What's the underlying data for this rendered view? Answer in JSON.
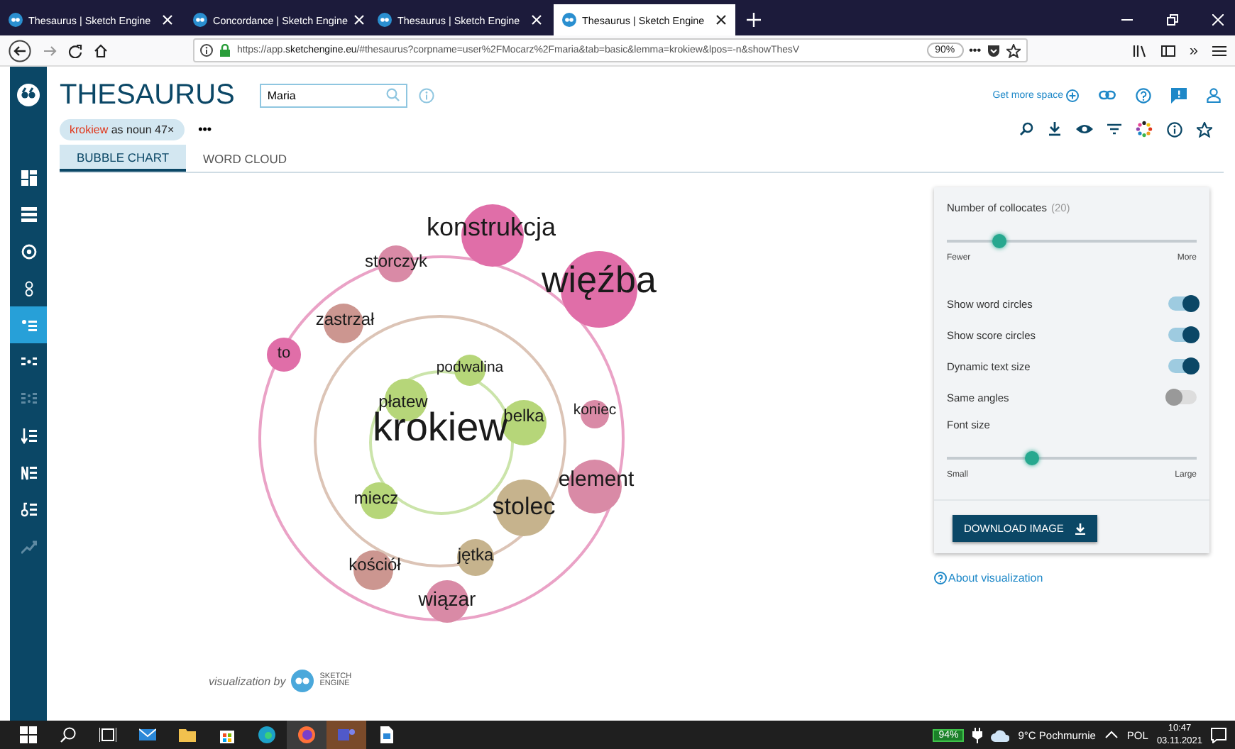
{
  "browser": {
    "tabs": [
      {
        "title": "Thesaurus | Sketch Engine",
        "selected": false
      },
      {
        "title": "Concordance | Sketch Engine",
        "selected": false
      },
      {
        "title": "Thesaurus | Sketch Engine",
        "selected": false
      },
      {
        "title": "Thesaurus | Sketch Engine",
        "selected": true
      }
    ],
    "url": "https://app.**sketchengine.eu**/#thesaurus?corpname=user%2FMocarz%2Fmaria&tab=basic&lemma=krokiew&lpos=-n&showThesV",
    "zoom": "90%",
    "overflow": "•••",
    "chevrons": "»"
  },
  "app": {
    "title": "THESAURUS",
    "search": {
      "value": "Maria"
    },
    "get_more_space": "Get more space",
    "query": {
      "lemma": "krokiew",
      "rest": "as noun 47×"
    },
    "more": "•••",
    "tabs": [
      {
        "label": "BUBBLE CHART",
        "selected": true
      },
      {
        "label": "WORD CLOUD",
        "selected": false
      }
    ],
    "sidebar": [
      {
        "selected": false
      },
      {
        "selected": false
      },
      {
        "selected": false
      },
      {
        "selected": false
      },
      {
        "selected": true
      },
      {
        "selected": false
      },
      {
        "selected": false
      },
      {
        "selected": false
      },
      {
        "selected": false
      },
      {
        "selected": false
      },
      {
        "selected": false
      }
    ]
  },
  "chart": {
    "headword": "krokiew",
    "bubbles": [
      {
        "word": "konstrukcja",
        "color": "#e06ea8"
      },
      {
        "word": "storczyk",
        "color": "#d98aa6"
      },
      {
        "word": "więźba",
        "color": "#e06ea8"
      },
      {
        "word": "zastrzał",
        "color": "#cc9690"
      },
      {
        "word": "to",
        "color": "#e06ea8"
      },
      {
        "word": "podwalina",
        "color": "#b6d679"
      },
      {
        "word": "płatew",
        "color": "#b6d679"
      },
      {
        "word": "belka",
        "color": "#b6d679"
      },
      {
        "word": "koniec",
        "color": "#d98aa6"
      },
      {
        "word": "element",
        "color": "#d98aa6"
      },
      {
        "word": "miecz",
        "color": "#b6d679"
      },
      {
        "word": "stolec",
        "color": "#c6b38d"
      },
      {
        "word": "jętka",
        "color": "#c6b38d"
      },
      {
        "word": "kościół",
        "color": "#cc9690"
      },
      {
        "word": "wiązar",
        "color": "#d98aa6"
      }
    ],
    "credit": "visualization by",
    "logo_text": "SKETCH ENGINE"
  },
  "panel": {
    "collocates": {
      "label": "Number of collocates",
      "count": "(20)",
      "level": 0.21,
      "min": "Fewer",
      "max": "More"
    },
    "toggles": [
      {
        "label": "Show word circles",
        "on": true
      },
      {
        "label": "Show score circles",
        "on": true
      },
      {
        "label": "Dynamic text size",
        "on": true
      },
      {
        "label": "Same angles",
        "on": false
      }
    ],
    "font_size": {
      "label": "Font size",
      "level": 0.34,
      "min": "Small",
      "max": "Large"
    },
    "download": "DOWNLOAD IMAGE",
    "about": "About visualization"
  },
  "taskbar": {
    "battery": "94%",
    "weather": "9°C Pochmurnie",
    "language": "POL",
    "time": "10:47",
    "date": "03.11.2021"
  }
}
